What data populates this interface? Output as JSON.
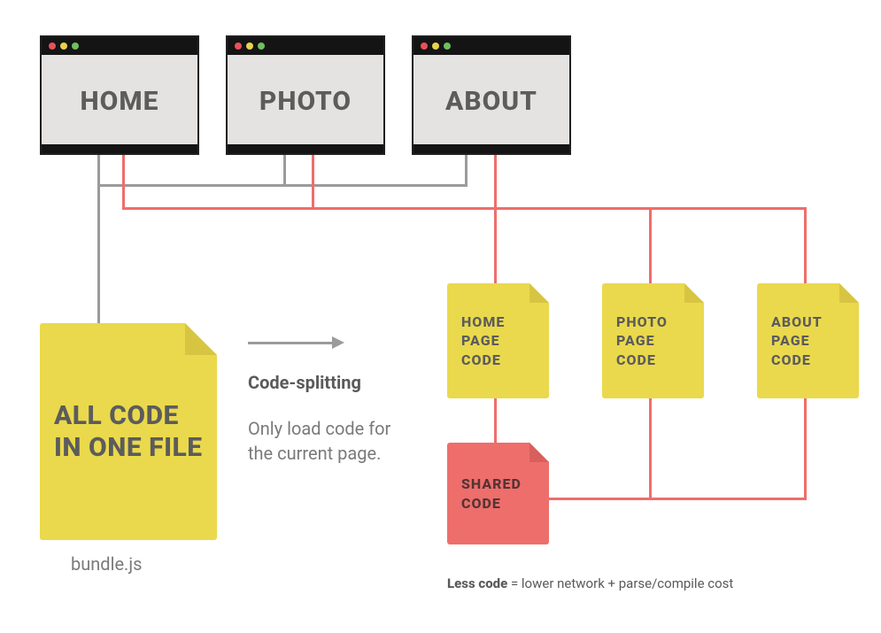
{
  "browsers": {
    "home": "HOME",
    "photo": "PHOTO",
    "about": "ABOUT"
  },
  "bundle": {
    "label": "ALL CODE IN ONE FILE",
    "filename": "bundle.js"
  },
  "arrow_caption": {
    "title": "Code-splitting",
    "desc": "Only load code for the current page."
  },
  "chunks": {
    "home": "HOME PAGE CODE",
    "photo": "PHOTO PAGE CODE",
    "about": "ABOUT PAGE CODE",
    "shared": "SHARED CODE"
  },
  "footnote": {
    "bold": "Less code",
    "rest": " = lower network + parse/compile cost"
  }
}
